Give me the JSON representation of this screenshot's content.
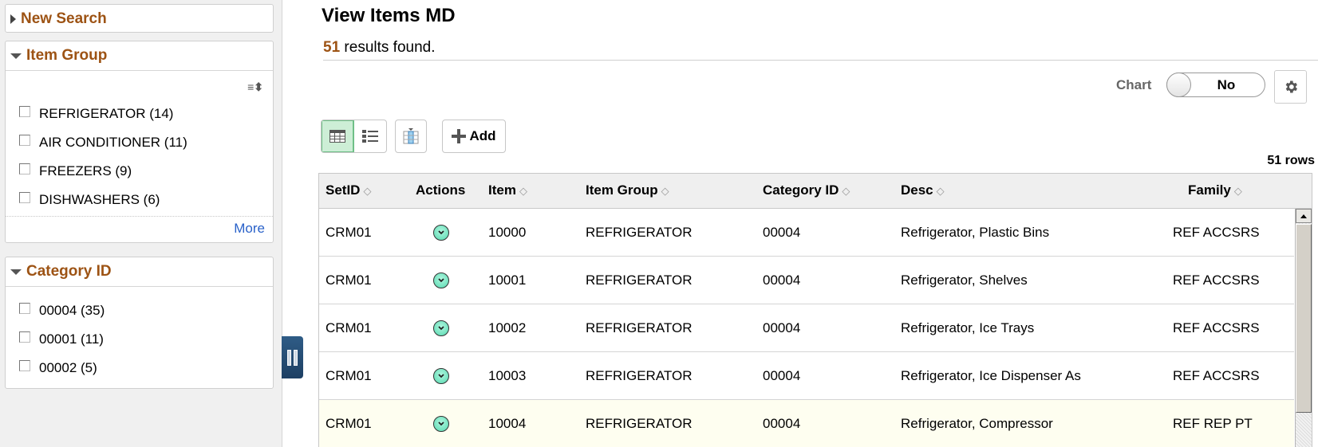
{
  "sidebar": {
    "new_search": "New Search",
    "item_group": {
      "title": "Item Group",
      "items": [
        {
          "label": "REFRIGERATOR (14)"
        },
        {
          "label": "AIR CONDITIONER (11)"
        },
        {
          "label": "FREEZERS (9)"
        },
        {
          "label": "DISHWASHERS (6)"
        }
      ],
      "more": "More"
    },
    "category_id": {
      "title": "Category ID",
      "items": [
        {
          "label": "00004 (35)"
        },
        {
          "label": "00001 (11)"
        },
        {
          "label": "00002 (5)"
        }
      ]
    }
  },
  "header": {
    "title": "View Items MD",
    "results_count": "51",
    "results_text": " results found."
  },
  "toolbar": {
    "chart_label": "Chart",
    "chart_toggle_value": "No",
    "add_label": "Add",
    "rows_count": "51 rows"
  },
  "grid": {
    "columns": [
      "SetID",
      "Actions",
      "Item",
      "Item Group",
      "Category ID",
      "Desc",
      "Family"
    ],
    "rows": [
      {
        "setid": "CRM01",
        "item": "10000",
        "item_group": "REFRIGERATOR",
        "category_id": "00004",
        "desc": "Refrigerator, Plastic Bins",
        "family": "REF ACCSRS"
      },
      {
        "setid": "CRM01",
        "item": "10001",
        "item_group": "REFRIGERATOR",
        "category_id": "00004",
        "desc": "Refrigerator, Shelves",
        "family": "REF ACCSRS"
      },
      {
        "setid": "CRM01",
        "item": "10002",
        "item_group": "REFRIGERATOR",
        "category_id": "00004",
        "desc": "Refrigerator, Ice Trays",
        "family": "REF ACCSRS"
      },
      {
        "setid": "CRM01",
        "item": "10003",
        "item_group": "REFRIGERATOR",
        "category_id": "00004",
        "desc": "Refrigerator, Ice Dispenser As",
        "family": "REF ACCSRS"
      },
      {
        "setid": "CRM01",
        "item": "10004",
        "item_group": "REFRIGERATOR",
        "category_id": "00004",
        "desc": "Refrigerator, Compressor",
        "family": "REF REP PT"
      }
    ]
  },
  "colors": {
    "accent_brown": "#9d5314",
    "link_blue": "#2a62c9",
    "active_view_green": "#cdeed6",
    "highlight_row": "#fefef0"
  }
}
